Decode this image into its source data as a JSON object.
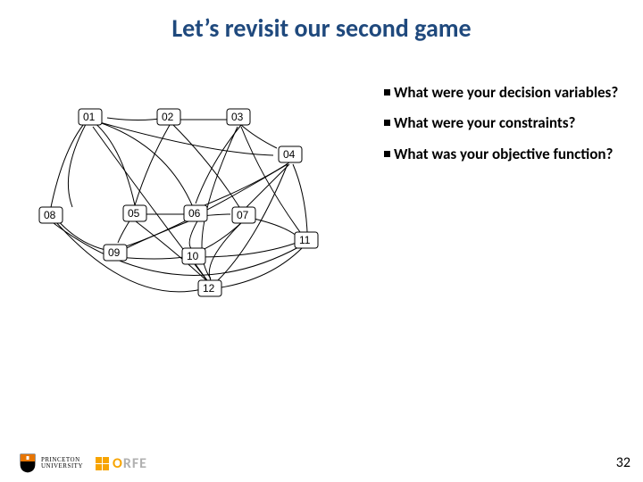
{
  "title": "Let’s revisit our second game",
  "bullets": [
    "What were your decision variables?",
    "What were your constraints?",
    "What was your objective function?"
  ],
  "nodes": {
    "n01": "01",
    "n02": "02",
    "n03": "03",
    "n04": "04",
    "n05": "05",
    "n06": "06",
    "n07": "07",
    "n08": "08",
    "n09": "09",
    "n10": "10",
    "n11": "11",
    "n12": "12"
  },
  "footer": {
    "princeton_line1": "PRINCETON",
    "princeton_line2": "UNIVERSITY",
    "orfe_o": "O",
    "orfe_rfe": "RFE"
  },
  "page_number": "32"
}
